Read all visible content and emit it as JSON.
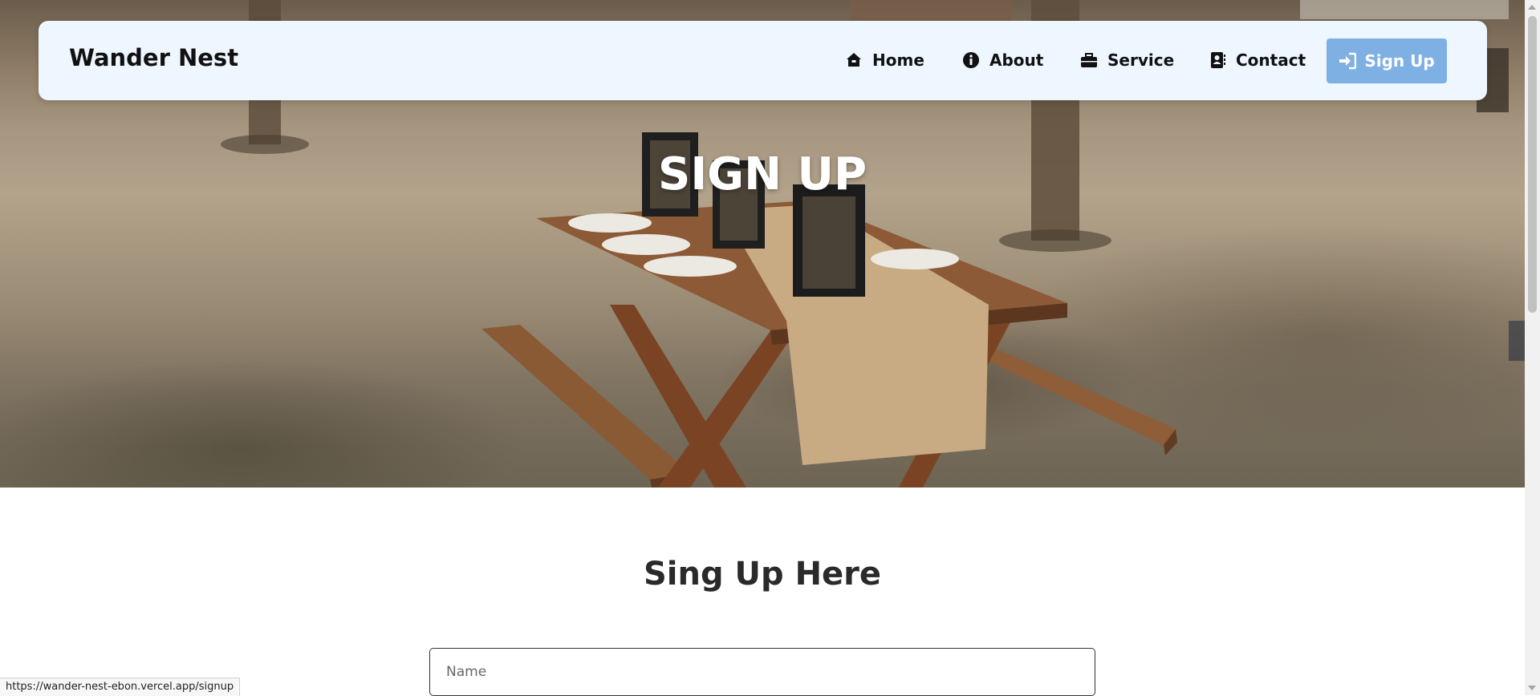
{
  "brand": "Wander Nest",
  "nav": {
    "items": [
      {
        "label": "Home",
        "icon": "home-icon"
      },
      {
        "label": "About",
        "icon": "info-icon"
      },
      {
        "label": "Service",
        "icon": "briefcase-icon"
      },
      {
        "label": "Contact",
        "icon": "contact-book-icon"
      }
    ],
    "signup_label": "Sign Up",
    "signup_icon": "sign-in-icon"
  },
  "hero": {
    "title": "SIGN UP"
  },
  "form": {
    "title": "Sing Up Here",
    "name_placeholder": "Name"
  },
  "status_url": "https://wander-nest-ebon.vercel.app/signup",
  "colors": {
    "navbar_bg": "#eef6ff",
    "signup_button": "#7fb0e3",
    "heading": "#2a2a2a"
  }
}
